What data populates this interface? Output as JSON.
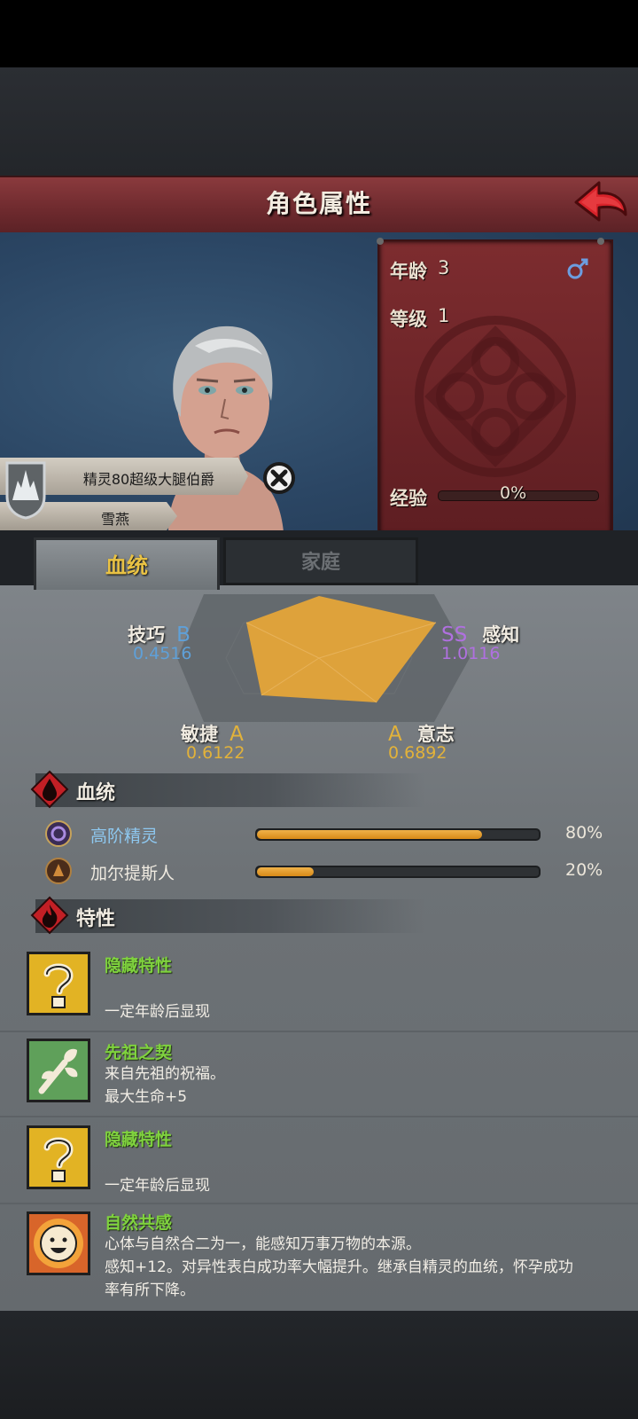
{
  "header": {
    "title": "角色属性",
    "back_icon": "back-arrow-icon"
  },
  "character": {
    "name_title": "精灵80超级大腿伯爵",
    "name": "雪燕",
    "age_label": "年龄",
    "age_value": "3",
    "level_label": "等级",
    "level_value": "1",
    "exp_label": "经验",
    "exp_value": "0%",
    "exp_fraction": 0,
    "gender_icon": "male-icon"
  },
  "tabs": [
    {
      "label": "血统",
      "active": true
    },
    {
      "label": "家庭",
      "active": false
    }
  ],
  "attributes": [
    {
      "name": "技巧",
      "grade": "B",
      "value": "0.4516",
      "grade_color": "#5fa0d8"
    },
    {
      "name": "感知",
      "grade": "SS",
      "value": "1.0116",
      "grade_color": "#b070e0"
    },
    {
      "name": "敏捷",
      "grade": "A",
      "value": "0.6122",
      "grade_color": "#e2b23a"
    },
    {
      "name": "意志",
      "grade": "A",
      "value": "0.6892",
      "grade_color": "#e2b23a"
    }
  ],
  "bloodline": {
    "title": "血统",
    "items": [
      {
        "name": "高阶精灵",
        "percent": "80%",
        "fraction": 0.8,
        "icon": "high-elf-emblem-icon"
      },
      {
        "name": "加尔提斯人",
        "percent": "20%",
        "fraction": 0.2,
        "icon": "garthis-emblem-icon"
      }
    ]
  },
  "traits": {
    "title": "特性",
    "items": [
      {
        "name": "隐藏特性",
        "line1": "",
        "line2": "一定年龄后显现",
        "line3": "",
        "icon": "hidden-trait-question-icon"
      },
      {
        "name": "先祖之契",
        "line1": "来自先祖的祝福。",
        "line2": "最大生命+5",
        "line3": "",
        "icon": "ancestral-branch-icon"
      },
      {
        "name": "隐藏特性",
        "line1": "",
        "line2": "一定年龄后显现",
        "line3": "",
        "icon": "hidden-trait-question-icon"
      },
      {
        "name": "自然共感",
        "line1": "心体与自然合二为一，能感知万事万物的本源。",
        "line2": "感知+12。对异性表白成功率大幅提升。继承自精灵的血统，怀孕成功",
        "line3": "率有所下降。",
        "icon": "nature-sun-face-icon"
      }
    ]
  },
  "colors": {
    "accent_title": "#7a2e32",
    "trait_name": "#7fd23e",
    "bar_fill": "#e39a24"
  }
}
